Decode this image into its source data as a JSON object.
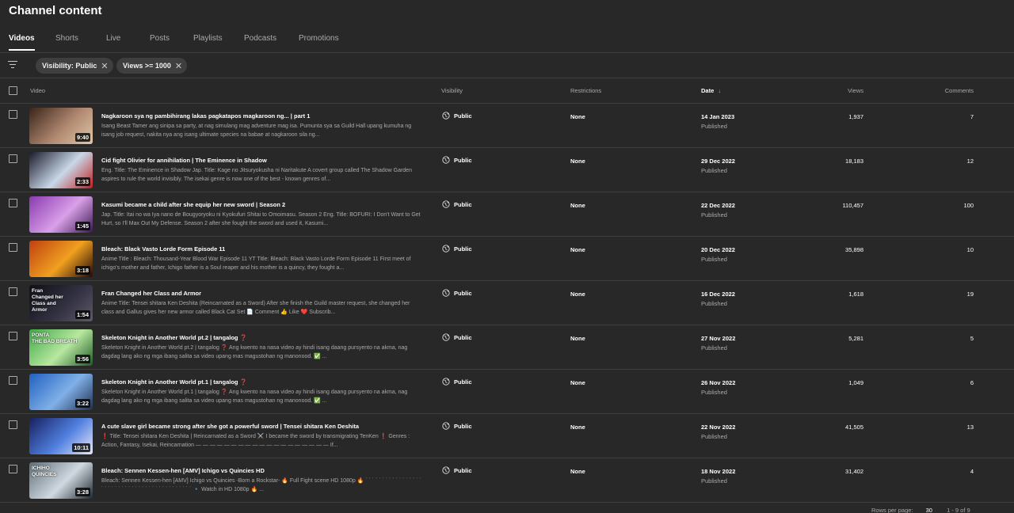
{
  "page_title": "Channel content",
  "tabs": [
    {
      "label": "Videos",
      "active": true
    },
    {
      "label": "Shorts"
    },
    {
      "label": "Live"
    },
    {
      "label": "Posts"
    },
    {
      "label": "Playlists"
    },
    {
      "label": "Podcasts"
    },
    {
      "label": "Promotions"
    }
  ],
  "filters": [
    {
      "label": "Visibility: Public",
      "icon": "close-icon"
    },
    {
      "label": "Views >= 1000",
      "icon": "close-icon"
    }
  ],
  "table": {
    "headers": {
      "video": "Video",
      "visibility": "Visibility",
      "restrictions": "Restrictions",
      "date": "Date",
      "views": "Views",
      "comments": "Comments"
    },
    "sort_icon": "arrow-down-icon",
    "rows": [
      {
        "duration": "9:40",
        "title": "Nagkaroon sya ng pambihirang lakas pagkatapos magkaroon ng... | part 1",
        "description": "Isang Beast Tamer ang sinipa sa party, at nag simulang mag adventure mag isa. Pumunta sya sa Guild Hall upang kumuha ng isang job request, nakita nya ang isang ultimate species na babae at nagkaroon sila ng...",
        "visibility": "Public",
        "restrictions": "None",
        "date": "14 Jan 2023",
        "status": "Published",
        "views": "1,937",
        "comments": "7",
        "thumb_colors": [
          "#3a2418",
          "#b08870",
          "#e0c8a8"
        ]
      },
      {
        "duration": "2:33",
        "title": "Cid fight Olivier for annihilation | The Eminence in Shadow",
        "description": "Eng. Title: The Eminence in Shadow Jap. Title: Kage no Jitsuryokusha ni Naritakute A covert group called The Shadow Garden aspires to rule the world invisibly. The isekai genre is now one of the best - known genres of...",
        "visibility": "Public",
        "restrictions": "None",
        "date": "29 Dec 2022",
        "status": "Published",
        "views": "18,183",
        "comments": "12",
        "thumb_colors": [
          "#1a1a2a",
          "#c8d8e8",
          "#c02020"
        ]
      },
      {
        "duration": "1:45",
        "title": "Kasumi became a child after she equip her new sword | Season 2",
        "description": "Jap. Title: Itai no wa Iya nano de Bougyoryoku ni Kyokufuri Shitai to Omoimasu. Season 2 Eng. Title: BOFURI: I Don't Want to Get Hurt, so I'll Max Out My Defense. Season 2 after she fought the sword and used it, Kasumi...",
        "visibility": "Public",
        "restrictions": "None",
        "date": "22 Dec 2022",
        "status": "Published",
        "views": "110,457",
        "comments": "100",
        "thumb_colors": [
          "#8a3ab0",
          "#d8a0e8",
          "#3a1850"
        ]
      },
      {
        "duration": "3:18",
        "title": "Bleach: Black Vasto Lorde Form Episode 11",
        "description": "Anime Title : Bleach: Thousand-Year Blood War Episode 11 YT Title: Bleach: Black Vasto Lorde Form Episode 11 First meet of ichigo's mother and father, Ichigo father is a Soul reaper and his mother is a quincy, they fought a...",
        "visibility": "Public",
        "restrictions": "None",
        "date": "20 Dec 2022",
        "status": "Published",
        "views": "35,898",
        "comments": "10",
        "thumb_colors": [
          "#c04010",
          "#f0a020",
          "#200808"
        ]
      },
      {
        "duration": "1:54",
        "title": "Fran Changed her Class and Armor",
        "description": "Anime Title: Tensei shitara Ken Deshita (Reincarnated as a Sword) After she finish the Guild master request, she changed her class and Gallus gives her new armor called Black Cat Set 📄 Comment 👍 Like ❤️ Subscrib...",
        "visibility": "Public",
        "restrictions": "None",
        "date": "16 Dec 2022",
        "status": "Published",
        "views": "1,618",
        "comments": "19",
        "thumb_colors": [
          "#101018",
          "#303040",
          "#605868"
        ],
        "thumb_text": [
          "Fran",
          "Changed her",
          "Class and",
          "Armor"
        ]
      },
      {
        "duration": "3:56",
        "title": "Skeleton Knight in Another World pt.2 | tangalog ❓",
        "description": "Skeleton Knight in Another World pt.2 | tangalog ❓ Ang kwento na nasa video ay hindi isang daang pursyento na akma, nag dagdag lang ako ng mga ibang salita sa video upang mas magustohan ng manonood. ✅ ...",
        "visibility": "Public",
        "restrictions": "None",
        "date": "27 Nov 2022",
        "status": "Published",
        "views": "5,281",
        "comments": "5",
        "thumb_colors": [
          "#40a848",
          "#b8e8a0",
          "#205828"
        ],
        "thumb_text": [
          "PONTA",
          "THE BAD BREATH"
        ]
      },
      {
        "duration": "3:22",
        "title": "Skeleton Knight in Another World pt.1 | tangalog ❓",
        "description": "Skeleton Knight in Another World pt.1 | tangalog ❓ Ang kwento na nasa video ay hindi isang daang pursyento na akma, nag dagdag lang ako ng mga ibang salita sa video upang mas magustohan ng manonood. ✅ ...",
        "visibility": "Public",
        "restrictions": "None",
        "date": "26 Nov 2022",
        "status": "Published",
        "views": "1,049",
        "comments": "6",
        "thumb_colors": [
          "#2060c0",
          "#80b0e8",
          "#203050"
        ]
      },
      {
        "duration": "10:11",
        "title": "A cute slave girl became strong after she got a powerful sword | Tensei shitara Ken Deshita",
        "description": "❗ Title: Tensei shitara Ken Deshita | Reincarnated as a Sword ⚔️ I became the sword by transmigrating TenKen ❗ Genres : Action, Fantasy, Isekai, Reincarnation — — — — — — — — — — — — — — — — — — — If...",
        "visibility": "Public",
        "restrictions": "None",
        "date": "22 Nov 2022",
        "status": "Published",
        "views": "41,505",
        "comments": "13",
        "thumb_colors": [
          "#182060",
          "#5080e0",
          "#e8e8f8"
        ]
      },
      {
        "duration": "3:28",
        "title": "Bleach: Sennen Kessen-hen [AMV] Ichigo vs Quincies HD",
        "description": "Bleach: Sennen Kessen-hen [AMV] Ichigo vs Quincies -Born a Rockstar- 🔥 Full Fight scene HD 1080p 🔥 ˙ ˙ ˙ ˙ ˙ ˙ ˙ ˙ ˙ ˙ ˙ ˙ ˙ ˙ ˙ ˙ ˙ ˙ ˙ ˙ ˙ ˙ ˙ ˙ ˙ ˙ ˙ ˙ ˙ ˙ ˙ ˙ ˙ ˙ ˙ ˙ ˙ ˙ ˙ ˙ ˙ ˙ ˙ ˙ 🔹 Watch in HD 1080p 🔥 ...",
        "visibility": "Public",
        "restrictions": "None",
        "date": "18 Nov 2022",
        "status": "Published",
        "views": "31,402",
        "comments": "4",
        "thumb_colors": [
          "#607078",
          "#d0d8e0",
          "#202830"
        ],
        "thumb_text": [
          "ICHIHO",
          "QUINCIES"
        ]
      }
    ]
  },
  "pagination": {
    "rows_label": "Rows per page:",
    "rows_value": "30",
    "range": "1 - 9 of 9"
  }
}
